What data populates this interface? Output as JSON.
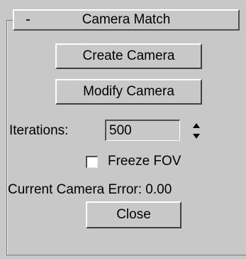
{
  "rollout": {
    "collapse_sign": "-",
    "title": "Camera Match"
  },
  "buttons": {
    "create_camera": "Create Camera",
    "modify_camera": "Modify Camera",
    "close": "Close"
  },
  "iterations": {
    "label": "Iterations:",
    "value": "500",
    "spinner_icon": "up-down-spinner-icon"
  },
  "freeze_fov": {
    "label": "Freeze FOV",
    "checked": false
  },
  "camera_error": {
    "label": "Current Camera Error:",
    "value": "0.00"
  },
  "colors": {
    "panel_bg": "#c8c8c8",
    "highlight": "#ffffff",
    "shadow": "#404040"
  }
}
